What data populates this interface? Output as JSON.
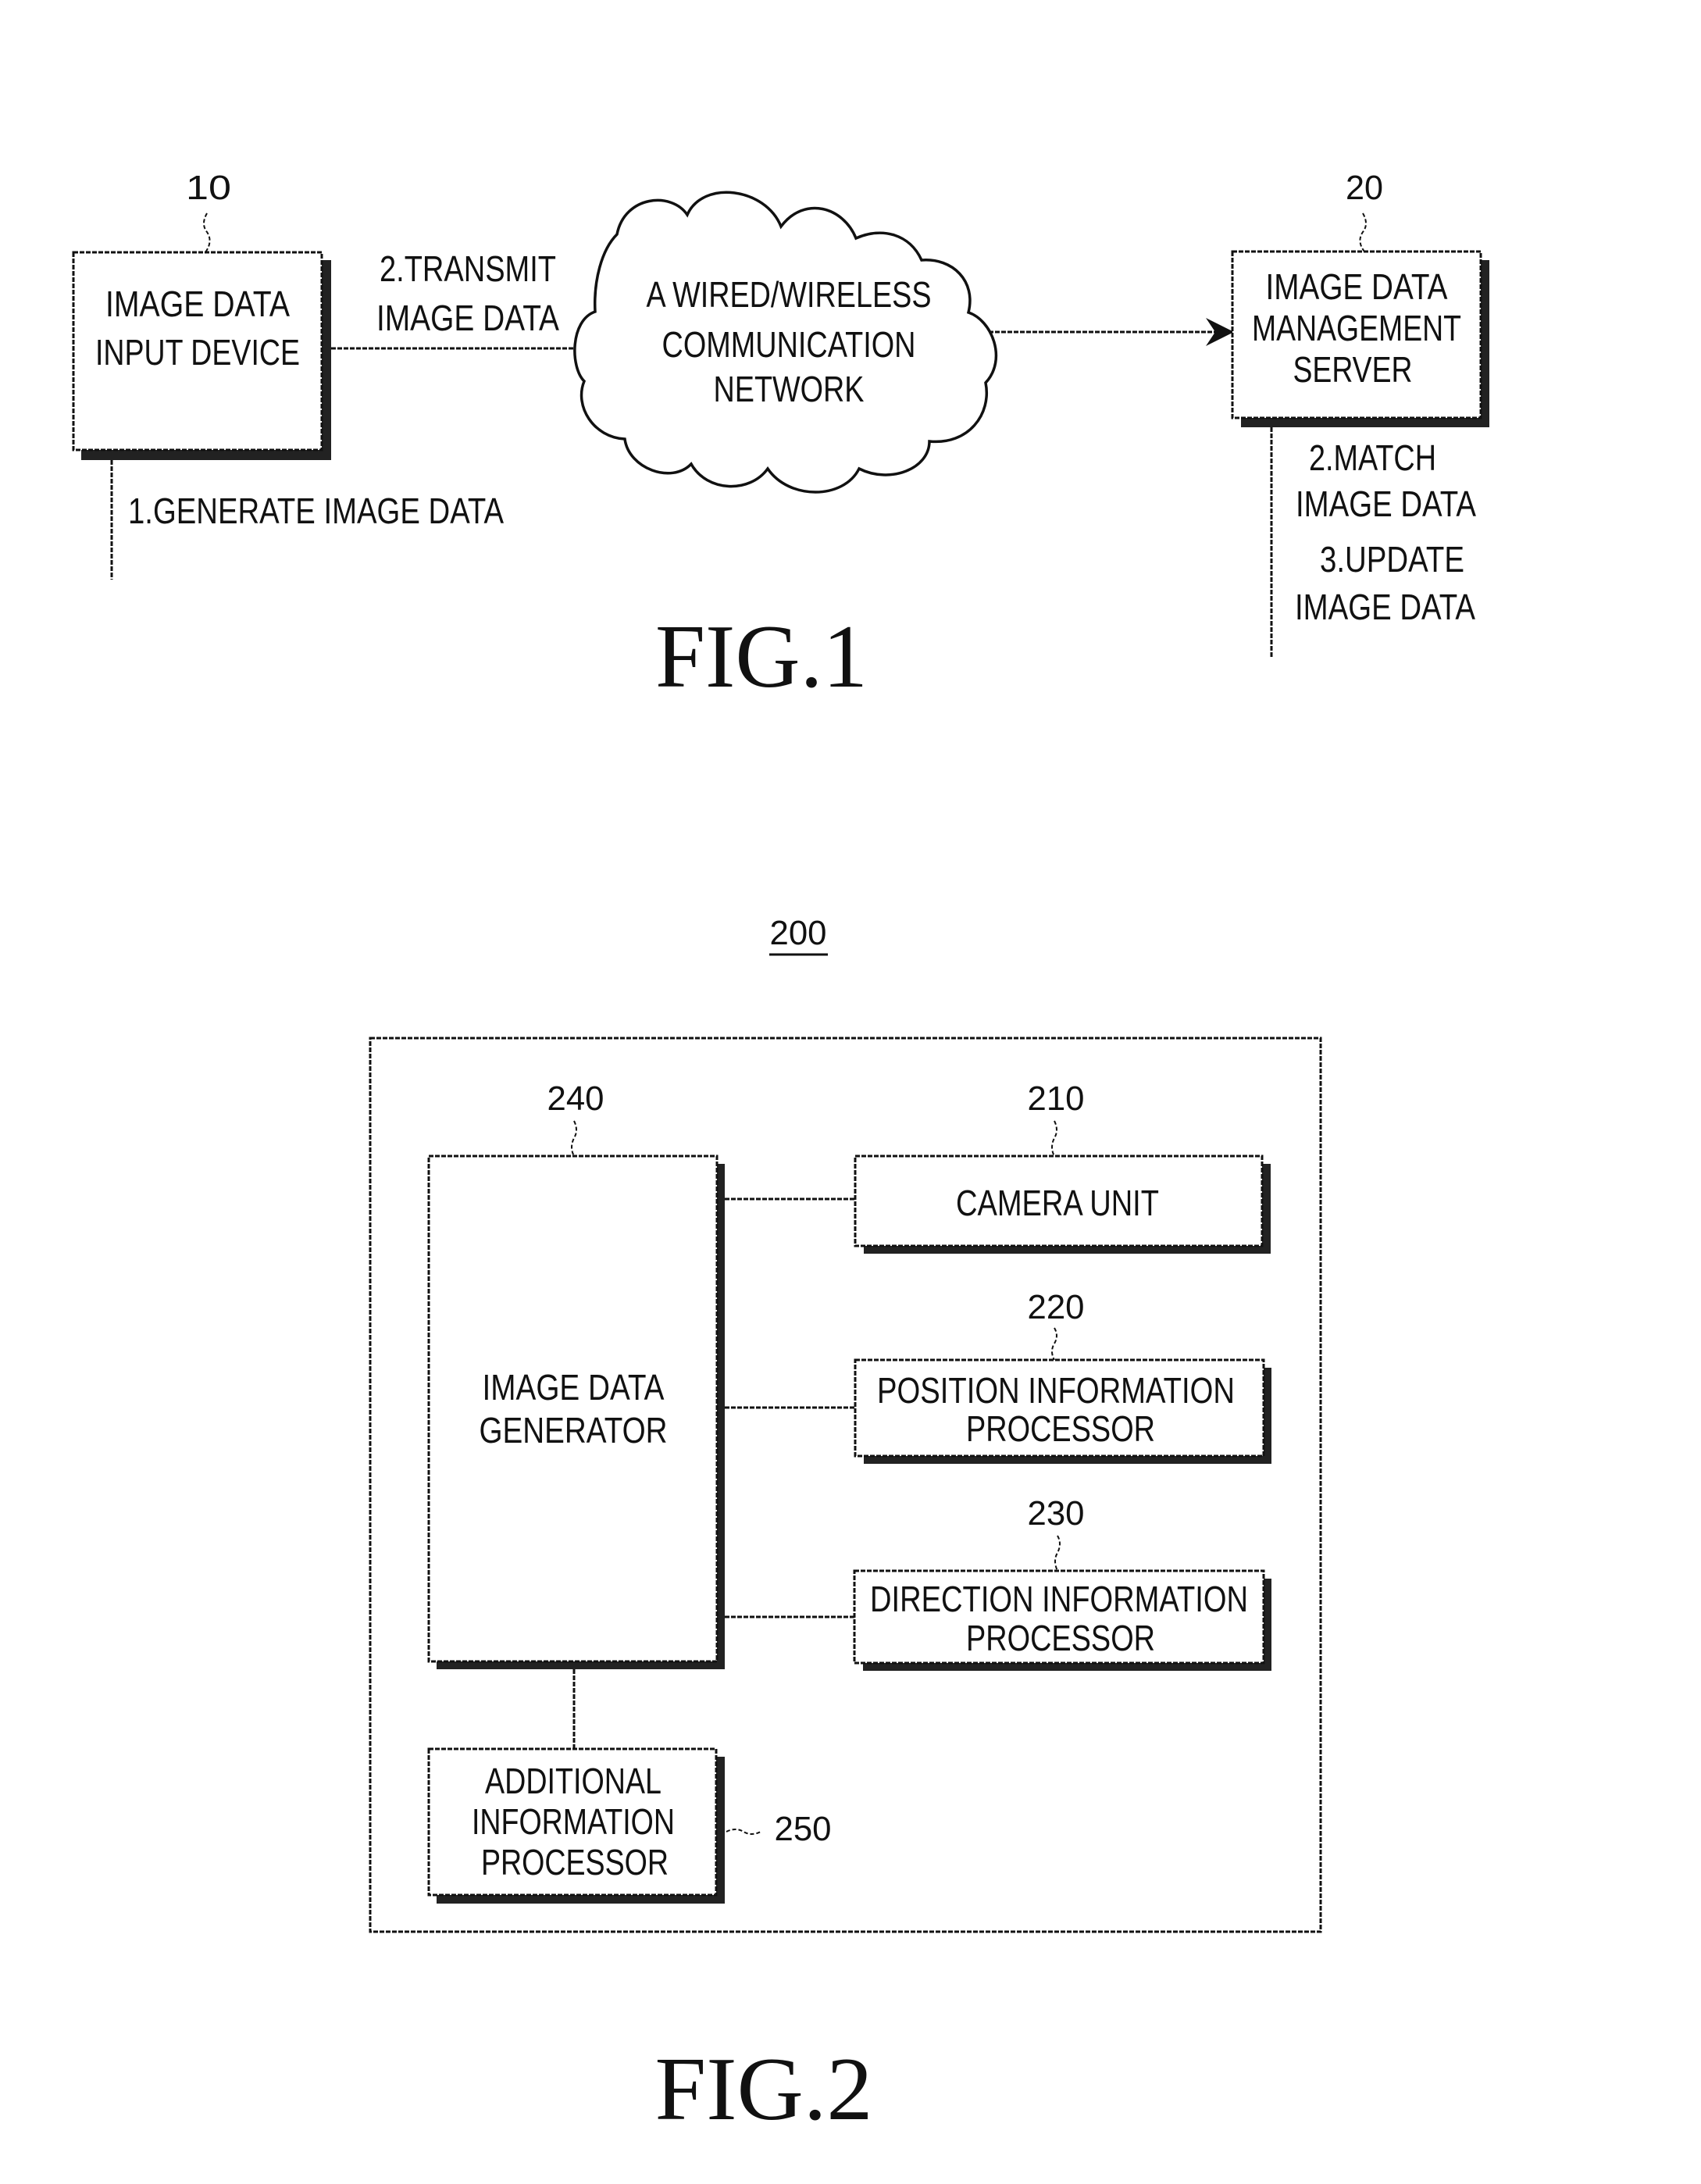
{
  "fig1": {
    "caption": "FIG.1",
    "input_device": {
      "ref": "10",
      "lines": [
        "IMAGE DATA",
        "INPUT DEVICE"
      ],
      "step": "1.GENERATE IMAGE DATA"
    },
    "transmit_label": [
      "2.TRANSMIT",
      "IMAGE DATA"
    ],
    "network": {
      "lines": [
        "A WIRED/WIRELESS",
        "COMMUNICATION",
        "NETWORK"
      ]
    },
    "server": {
      "ref": "20",
      "lines": [
        "IMAGE DATA",
        "MANAGEMENT",
        "SERVER"
      ],
      "steps": [
        "2.MATCH",
        "IMAGE DATA",
        "3.UPDATE",
        "IMAGE DATA"
      ]
    }
  },
  "fig2": {
    "caption": "FIG.2",
    "container_ref": "200",
    "generator": {
      "ref": "240",
      "lines": [
        "IMAGE DATA",
        "GENERATOR"
      ]
    },
    "camera": {
      "ref": "210",
      "lines": [
        "CAMERA UNIT"
      ]
    },
    "position": {
      "ref": "220",
      "lines": [
        "POSITION INFORMATION",
        "PROCESSOR"
      ]
    },
    "direction": {
      "ref": "230",
      "lines": [
        "DIRECTION INFORMATION",
        "PROCESSOR"
      ]
    },
    "additional": {
      "ref": "250",
      "lines": [
        "ADDITIONAL",
        "INFORMATION",
        "PROCESSOR"
      ]
    }
  }
}
